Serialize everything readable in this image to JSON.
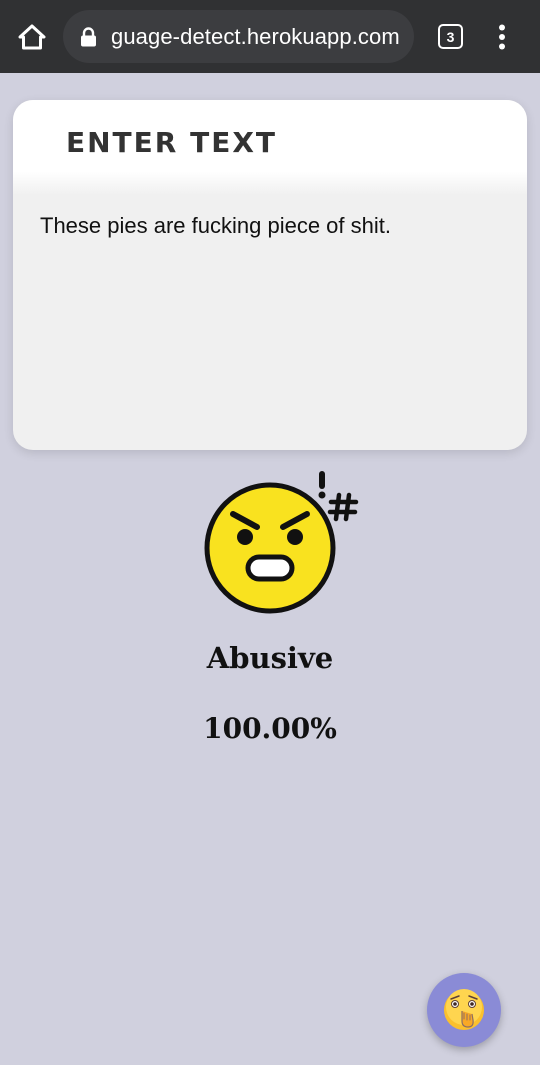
{
  "browser": {
    "url": "guage-detect.herokuapp.com",
    "tab_count": "3",
    "home_icon": "home-icon",
    "lock_icon": "lock-icon",
    "menu_icon": "more-vert-icon"
  },
  "card": {
    "title": "ENTER TEXT",
    "input_value": "These pies are fucking piece of shit."
  },
  "result": {
    "emoji_icon": "angry-face-icon",
    "label": "Abusive",
    "score": "100.00%"
  },
  "fab": {
    "icon": "shushing-face-icon"
  },
  "colors": {
    "page_background": "#d0d0de",
    "browser_bar": "#303133",
    "card_background": "#f0f0f0",
    "fab_background": "#8a8bd6",
    "emoji_yellow": "#f9e21f"
  }
}
